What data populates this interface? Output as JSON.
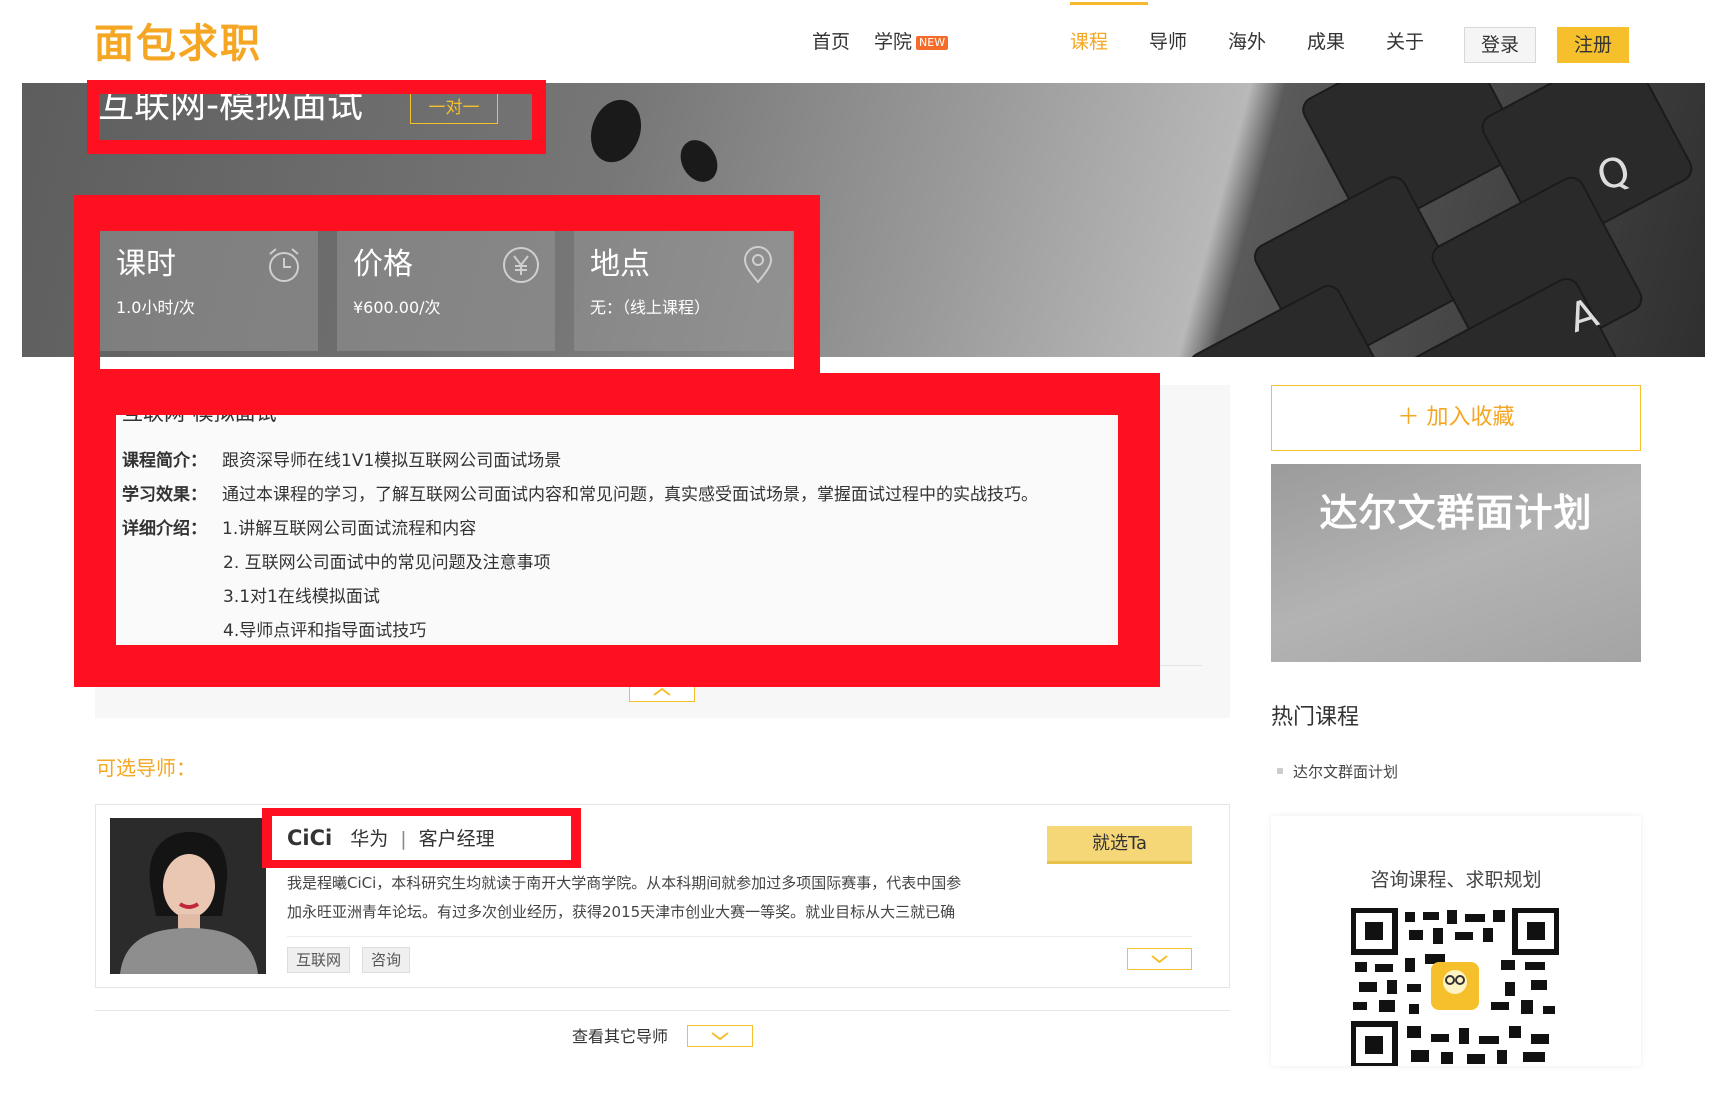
{
  "nav": {
    "logo": "面包求职",
    "items": [
      {
        "label": "首页"
      },
      {
        "label": "学院",
        "badge": "NEW"
      },
      {
        "label": "课程",
        "active": true
      },
      {
        "label": "导师"
      },
      {
        "label": "海外"
      },
      {
        "label": "成果"
      },
      {
        "label": "关于"
      }
    ],
    "login": "登录",
    "register": "注册"
  },
  "hero": {
    "title": "互联网-模拟面试",
    "tag": "一对一",
    "keys": [
      "Q",
      "A"
    ],
    "cards": [
      {
        "title": "课时",
        "value": "1.0小时/次",
        "icon": "alarm-clock-icon"
      },
      {
        "title": "价格",
        "value": "¥600.00/次",
        "icon": "yen-circle-icon"
      },
      {
        "title": "地点",
        "value": "无：（线上课程）",
        "icon": "location-pin-icon"
      }
    ]
  },
  "detail": {
    "heading": "互联网-模拟面试",
    "intro_label": "课程简介：",
    "intro": "跟资深导师在线1V1模拟互联网公司面试场景",
    "effect_label": "学习效果：",
    "effect": "通过本课程的学习，了解互联网公司面试内容和常见问题，真实感受面试场景，掌握面试过程中的实战技巧。",
    "detail_label": "详细介绍：",
    "points": [
      "1.讲解互联网公司面试流程和内容",
      "2. 互联网公司面试中的常见问题及注意事项",
      "3.1对1在线模拟面试",
      "4.导师点评和指导面试技巧"
    ]
  },
  "mentors": {
    "label": "可选导师：",
    "items": [
      {
        "name": "CiCi",
        "company": "华为",
        "title": "客户经理",
        "desc1": "我是程曦CiCi，本科研究生均就读于南开大学商学院。从本科期间就参加过多项国际赛事，代表中国参",
        "desc2": "加永旺亚洲青年论坛。有过多次创业经历，获得2015天津市创业大赛一等奖。就业目标从大三就已确",
        "choose": "就选Ta",
        "tags": [
          "互联网",
          "咨询"
        ]
      }
    ],
    "more": "查看其它导师"
  },
  "sidebar": {
    "favorite": "＋  加入收藏",
    "promo": "达尔文群面计划",
    "hot_title": "热门课程",
    "hot_items": [
      "达尔文群面计划"
    ],
    "qr_title": "咨询课程、求职规划"
  },
  "colors": {
    "accent": "#f5a623",
    "button": "#f5c02b",
    "annotation": "#ff1020"
  }
}
